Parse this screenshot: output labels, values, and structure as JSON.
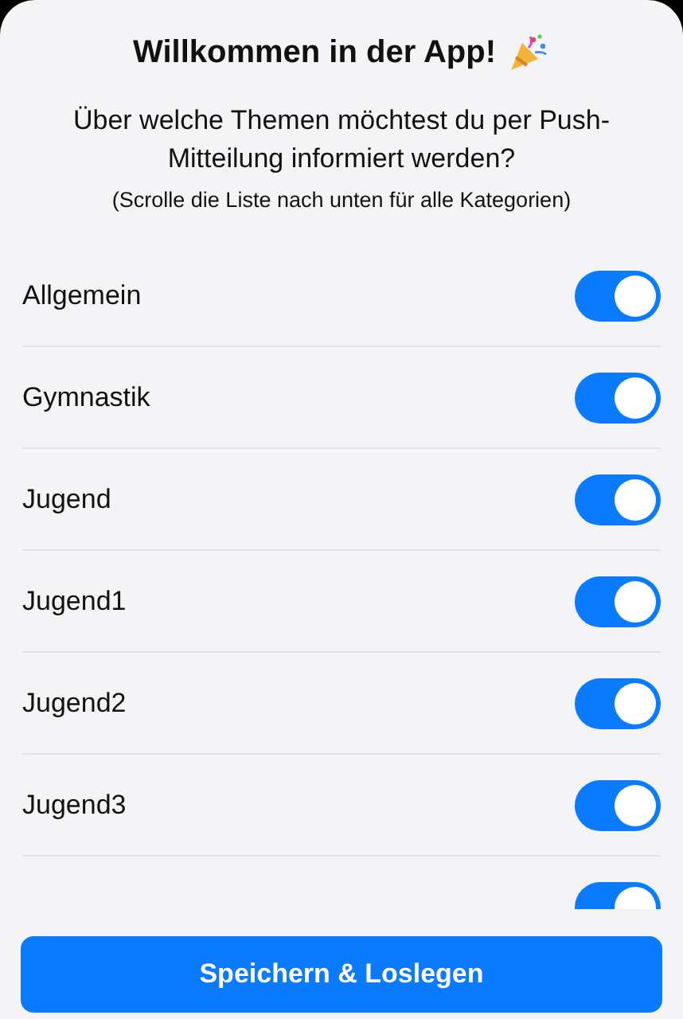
{
  "title": "Willkommen in der App!",
  "subtitle": "Über welche Themen möchtest du per Push-Mitteilung informiert werden?",
  "hint": "(Scrolle die Liste nach unten für alle Kategorien)",
  "topics": [
    {
      "label": "Allgemein",
      "on": true
    },
    {
      "label": "Gymnastik",
      "on": true
    },
    {
      "label": "Jugend",
      "on": true
    },
    {
      "label": "Jugend1",
      "on": true
    },
    {
      "label": "Jugend2",
      "on": true
    },
    {
      "label": "Jugend3",
      "on": true
    },
    {
      "on": true
    }
  ],
  "button": "Speichern & Loslegen"
}
